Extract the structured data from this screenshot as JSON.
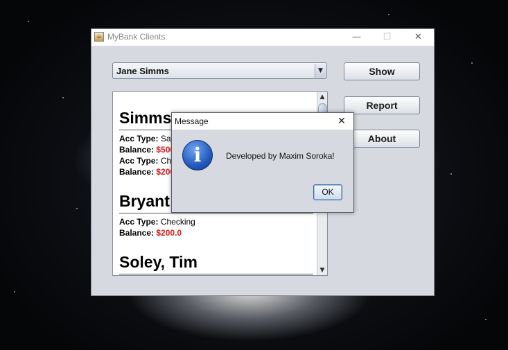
{
  "window": {
    "title": "MyBank Clients",
    "minimize_glyph": "—",
    "maximize_glyph": "☐",
    "close_glyph": "✕"
  },
  "combo": {
    "selected": "Jane Simms",
    "arrow_glyph": "▼"
  },
  "buttons": {
    "show": "Show",
    "report": "Report",
    "about": "About"
  },
  "scrollbar": {
    "up_glyph": "▲",
    "down_glyph": "▼"
  },
  "labels": {
    "acc_type": "Acc Type:",
    "balance": "Balance:"
  },
  "clients": [
    {
      "name": "Simms, Jane",
      "name_visible": "Simms",
      "accounts": [
        {
          "type": "Savings",
          "type_visible": "Sav",
          "balance": "$500",
          "balance_visible": "$500"
        },
        {
          "type": "Checking",
          "type_visible": "Che",
          "balance": "$200",
          "balance_visible": "$200"
        }
      ]
    },
    {
      "name": "Bryant",
      "name_visible": "Bryant",
      "accounts": [
        {
          "type": "Checking",
          "type_visible": "Checking",
          "balance": "$200.0",
          "balance_visible": "$200.0"
        }
      ]
    },
    {
      "name": "Soley, Tim",
      "name_visible": "Soley, Tim",
      "accounts": []
    }
  ],
  "dialog": {
    "title": "Message",
    "close_glyph": "✕",
    "icon_glyph": "i",
    "message": "Developed by Maxim Soroka!",
    "ok_label": "OK"
  },
  "colors": {
    "money": "#e21b1b",
    "window_bg": "#d6d9df"
  },
  "icons": {
    "app": "java-cup-icon",
    "dialog": "information-icon"
  }
}
